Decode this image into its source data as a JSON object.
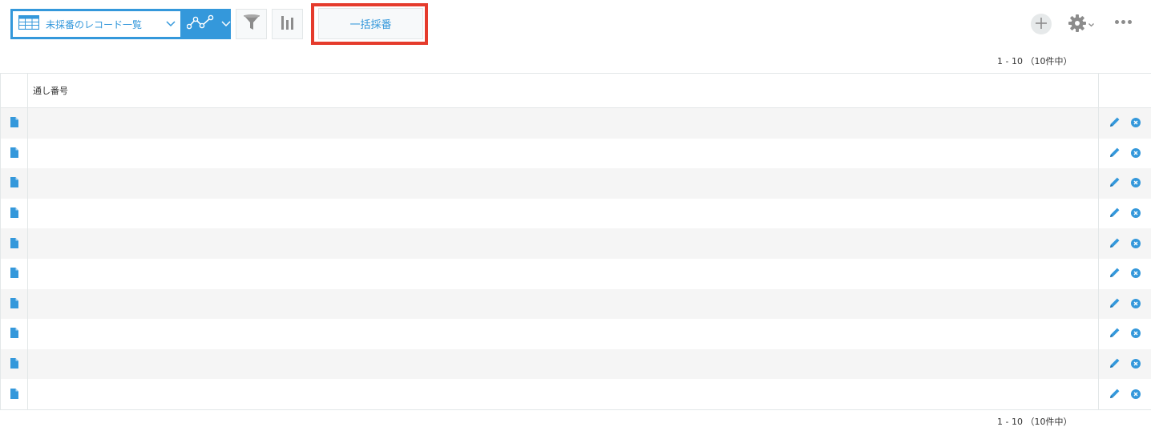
{
  "toolbar": {
    "view_select_label": "未採番のレコード一覧",
    "bulk_button_label": "一括採番"
  },
  "icons": {
    "view_list": "table-list-icon",
    "graph": "line-graph-icon",
    "filter": "filter-funnel-icon",
    "bar_graph": "bar-chart-icon",
    "add": "plus-icon",
    "settings": "gear-icon",
    "more": "more-dots-icon",
    "record_detail": "document-icon",
    "edit": "pencil-icon",
    "delete": "close-circle-icon"
  },
  "colors": {
    "accent": "#3498db",
    "highlight": "#e53b2c",
    "row_alt": "#f5f5f5"
  },
  "pagination": {
    "top": "1 - 10 （10件中）",
    "bottom": "1 - 10 （10件中）"
  },
  "table": {
    "columns": [
      "通し番号"
    ],
    "rows": [
      {
        "serial": ""
      },
      {
        "serial": ""
      },
      {
        "serial": ""
      },
      {
        "serial": ""
      },
      {
        "serial": ""
      },
      {
        "serial": ""
      },
      {
        "serial": ""
      },
      {
        "serial": ""
      },
      {
        "serial": ""
      },
      {
        "serial": ""
      }
    ]
  }
}
